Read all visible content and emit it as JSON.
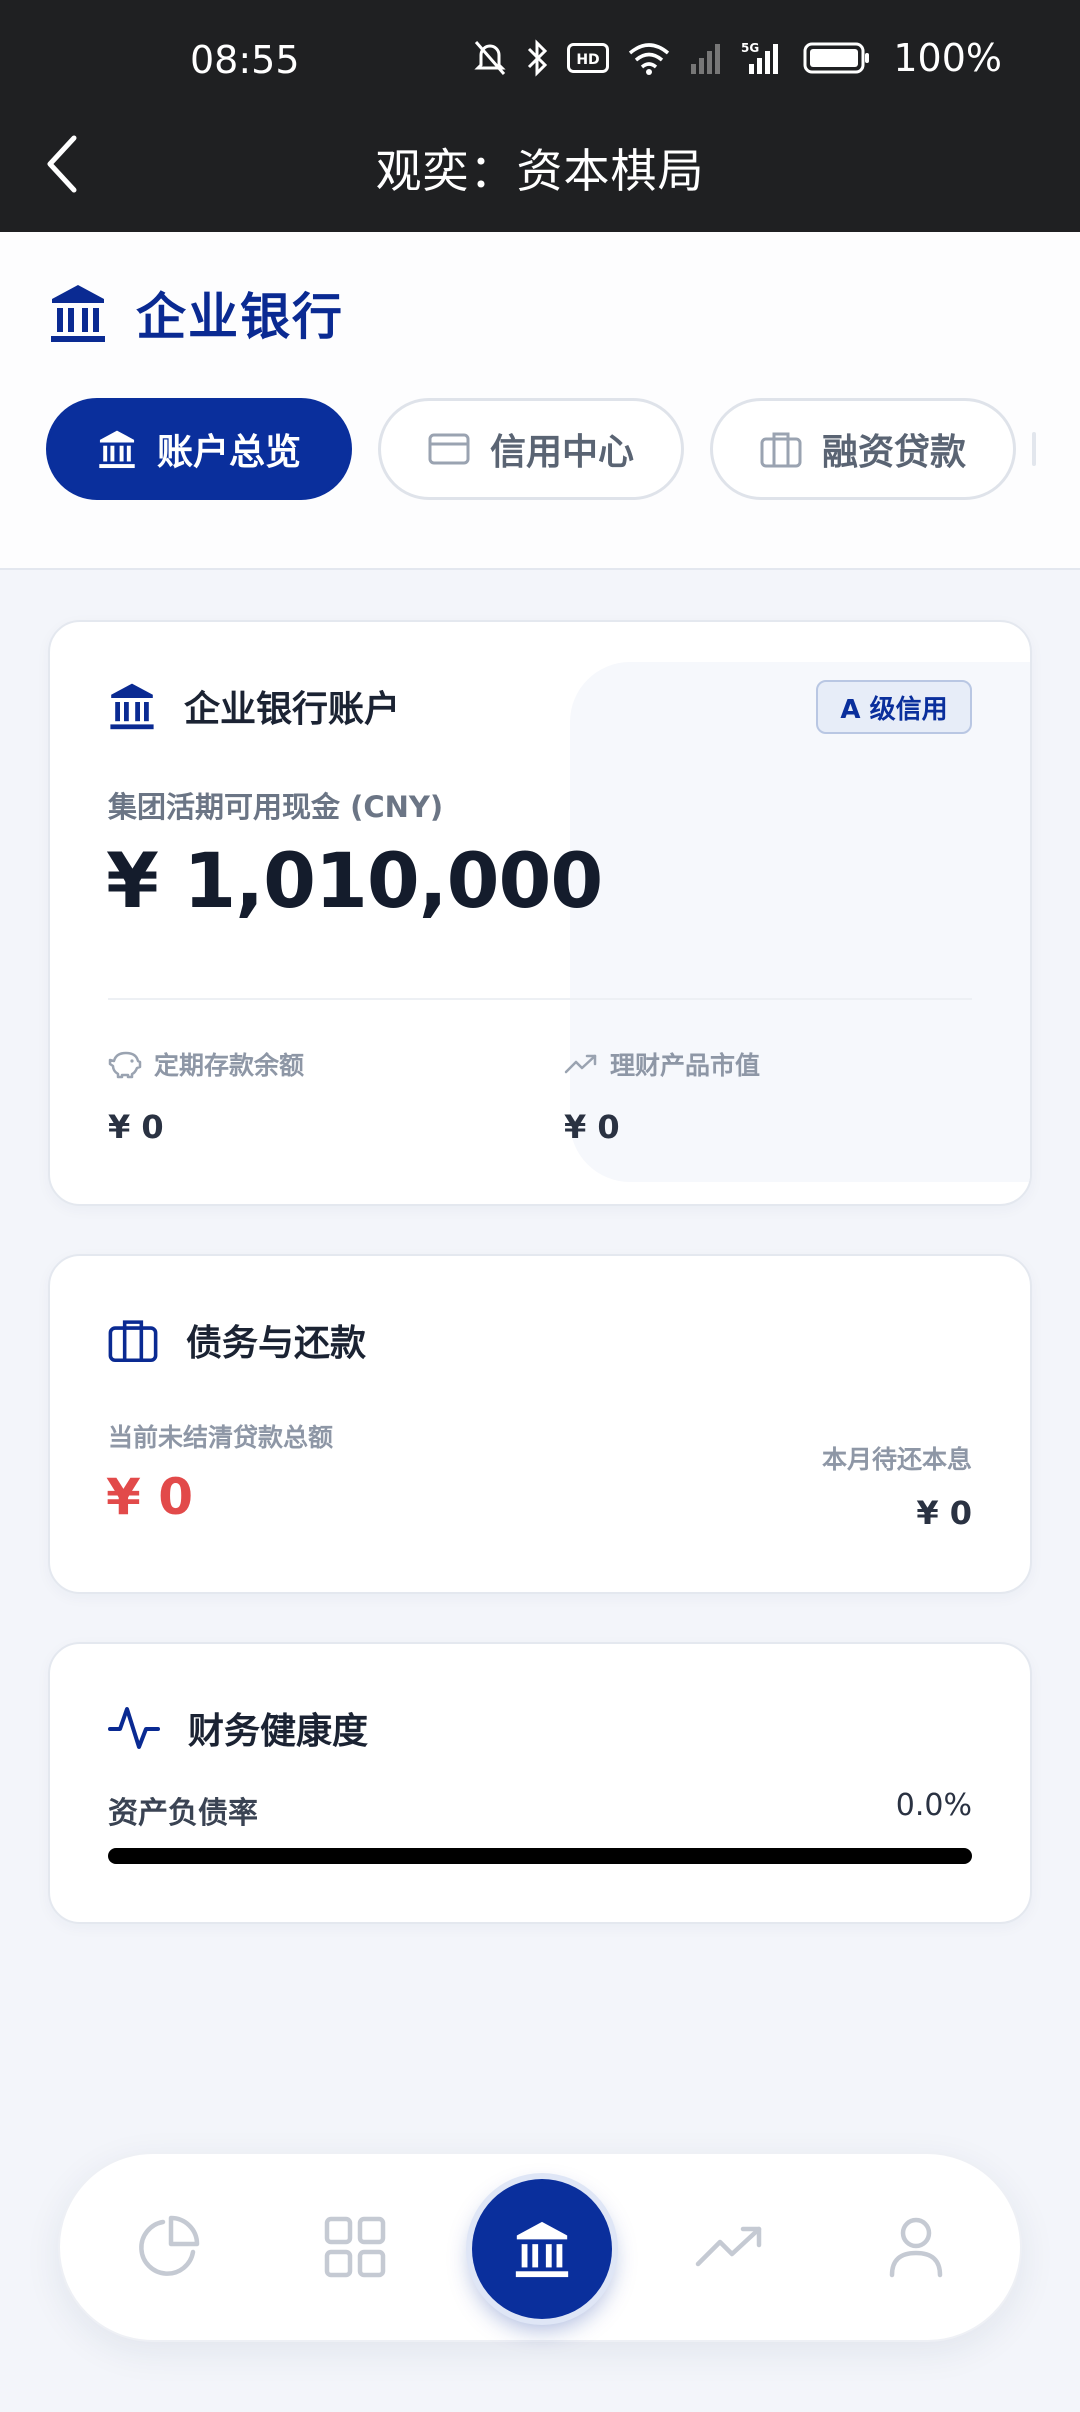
{
  "status_bar": {
    "time": "08:55",
    "battery": "100%"
  },
  "app": {
    "title": "观奕：资本棋局"
  },
  "header": {
    "brand": "企业银行",
    "tabs": [
      {
        "label": "账户总览",
        "icon": "bank-icon",
        "active": true
      },
      {
        "label": "信用中心",
        "icon": "credit-card-icon",
        "active": false
      },
      {
        "label": "融资贷款",
        "icon": "briefcase-icon",
        "active": false
      }
    ]
  },
  "account_card": {
    "title": "企业银行账户",
    "credit_badge": "A 级信用",
    "cash_label": "集团活期可用现金 (CNY)",
    "cash_value": "¥ 1,010,000",
    "fixed_deposit_label": "定期存款余额",
    "fixed_deposit_value": "¥ 0",
    "wealth_label": "理财产品市值",
    "wealth_value": "¥ 0"
  },
  "debt_card": {
    "title": "债务与还款",
    "outstanding_label": "当前未结清贷款总额",
    "outstanding_value": "¥ 0",
    "monthly_label": "本月待还本息",
    "monthly_value": "¥ 0"
  },
  "health_card": {
    "title": "财务健康度",
    "ratio_label": "资产负债率",
    "ratio_value": "0.0%",
    "ratio_fraction": 0.0
  },
  "bottom_nav": {
    "items": [
      "pie-chart-icon",
      "grid-icon",
      "bank-icon",
      "trending-up-icon",
      "user-icon"
    ],
    "active_index": 2
  },
  "colors": {
    "brand": "#0a2f9c",
    "danger": "#e24a4a",
    "topbar": "#1f2022",
    "background": "#f3f5fa"
  }
}
